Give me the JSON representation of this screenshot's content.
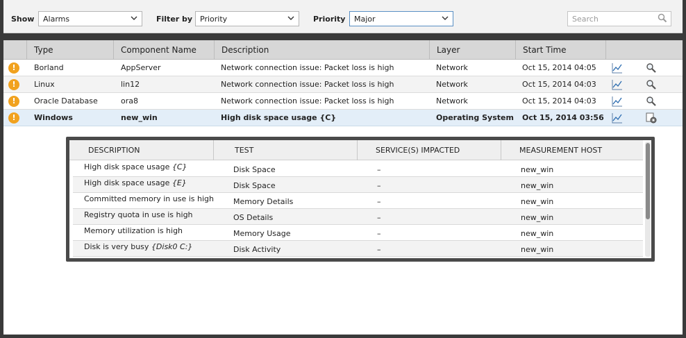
{
  "filters": {
    "show_label": "Show",
    "show_value": "Alarms",
    "filterby_label": "Filter by",
    "filterby_value": "Priority",
    "priority_label": "Priority",
    "priority_value": "Major",
    "search_placeholder": "Search"
  },
  "alarm_table": {
    "headers": [
      "Type",
      "Component Name",
      "Description",
      "Layer",
      "Start Time"
    ],
    "rows": [
      {
        "type": "Borland",
        "component": "AppServer",
        "description": "Network connection issue: Packet loss is high",
        "layer": "Network",
        "start": "Oct 15, 2014 04:05"
      },
      {
        "type": "Linux",
        "component": "lin12",
        "description": "Network connection issue: Packet loss is high",
        "layer": "Network",
        "start": "Oct 15, 2014 04:03"
      },
      {
        "type": "Oracle Database",
        "component": "ora8",
        "description": "Network connection issue: Packet loss is high",
        "layer": "Network",
        "start": "Oct 15, 2014 04:03"
      },
      {
        "type": "Windows",
        "component": "new_win",
        "description": "High disk space usage {C}",
        "layer": "Operating System",
        "start": "Oct 15, 2014 03:56"
      }
    ],
    "alarm_glyph": "!",
    "icons": [
      "graph-icon",
      "magnifier-icon",
      "gear-icon"
    ],
    "alarm_color": "#f1a21f"
  },
  "details_panel": {
    "headers": [
      "DESCRIPTION",
      "TEST",
      "SERVICE(S) IMPACTED",
      "MEASUREMENT HOST"
    ],
    "rows": [
      {
        "desc": "High disk space usage",
        "desc_arg": "{C}",
        "test": "Disk Space",
        "service": "–",
        "host": "new_win"
      },
      {
        "desc": "High disk space usage",
        "desc_arg": "{E}",
        "test": "Disk Space",
        "service": "–",
        "host": "new_win"
      },
      {
        "desc": "Committed memory in use is high",
        "desc_arg": "",
        "test": "Memory Details",
        "service": "–",
        "host": "new_win"
      },
      {
        "desc": "Registry quota in use is high",
        "desc_arg": "",
        "test": "OS Details",
        "service": "–",
        "host": "new_win"
      },
      {
        "desc": "Memory utilization is high",
        "desc_arg": "",
        "test": "Memory Usage",
        "service": "–",
        "host": "new_win"
      },
      {
        "desc": "Disk is very busy",
        "desc_arg": "{Disk0 C:}",
        "test": "Disk Activity",
        "service": "–",
        "host": "new_win"
      }
    ]
  }
}
